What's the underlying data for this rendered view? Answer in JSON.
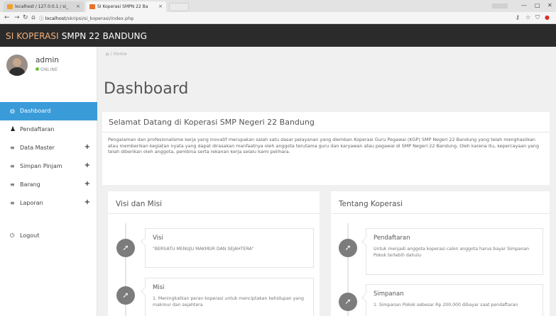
{
  "browser": {
    "tabs": [
      {
        "title": "localhost / 127.0.0.1 / si_",
        "close": "×",
        "color": "#f0a030"
      },
      {
        "title": "SI Koperasi SMPN 22 Ba",
        "close": "×",
        "color": "#e8712b"
      }
    ],
    "url_scheme": "localhost",
    "url_path": "/skripsi/si_koperasi/index.php",
    "info_icon": "ⓘ",
    "window_controls": [
      "—",
      "□",
      "✕"
    ],
    "toolbar_icons": [
      "key-icon",
      "star-icon",
      "shield-icon",
      "extension-icon"
    ]
  },
  "app": {
    "brand_part1": "SI KOPERASI",
    "brand_part2": "SMPN 22 BANDUNG",
    "accent_color": "#3a9bd9",
    "header_color": "#2b2b2b"
  },
  "user": {
    "name": "admin",
    "status": "ONLINE"
  },
  "sidebar": {
    "items": [
      {
        "label": "Dashboard",
        "icon": "dashboard-icon",
        "glyph": "◍",
        "expandable": false,
        "active": true
      },
      {
        "label": "Pendaftaran",
        "icon": "user-icon",
        "glyph": "👤",
        "expandable": false,
        "active": false
      },
      {
        "label": "Data Master",
        "icon": "list-icon",
        "glyph": "≡",
        "expandable": true,
        "active": false
      },
      {
        "label": "Simpan Pinjam",
        "icon": "list-icon",
        "glyph": "≡",
        "expandable": true,
        "active": false
      },
      {
        "label": "Barang",
        "icon": "list-icon",
        "glyph": "≡",
        "expandable": true,
        "active": false
      },
      {
        "label": "Laporan",
        "icon": "list-icon",
        "glyph": "≡",
        "expandable": true,
        "active": false
      },
      {
        "label": "Logout",
        "icon": "power-icon",
        "glyph": "⏻",
        "expandable": false,
        "active": false
      }
    ],
    "expand_symbol": "+"
  },
  "breadcrumb": {
    "home_label": "Home",
    "separator": "/"
  },
  "page": {
    "title": "Dashboard"
  },
  "welcome": {
    "title": "Selamat Datang di Koperasi SMP Negeri 22 Bandung",
    "text": "Pengalaman dan profesionalisme kerja yang inovatif merupakan salah satu dasar pelayanan yang diemban Koperasi Guru Pegawai (KGP) SMP Negeri 22 Bandung yang telah menghasilkan atau memberikan kegiatan nyata yang dapat dirasakan manfaatnya oleh anggota terutama guru dan karyawan atau pegawai di SMP Negeri 22 Bandung. Oleh karena itu, kepercayaan yang telah diberikan oleh anggota, pembina serta rekanan kerja selalu kami pelihara."
  },
  "visi_misi": {
    "title": "Visi dan Misi",
    "items": [
      {
        "heading": "Visi",
        "body": "\"BERSATU MENUJU MAKMUR DAN SEJAHTERA\""
      },
      {
        "heading": "Misi",
        "body": "1. Meningkatkan peran koperasi untuk menciptakan kehidupan yang makmur dan sejahtera"
      }
    ]
  },
  "tentang": {
    "title": "Tentang Koperasi",
    "items": [
      {
        "heading": "Pendaftaran",
        "body": "Untuk menjadi anggota koperasi calon anggota harus bayar Simpanan Pokok terlebih dahulu"
      },
      {
        "heading": "Simpanan",
        "body": "1. Simpanan Pokok sebesar Rp 200.000 dibayar saat pendaftaran"
      }
    ]
  }
}
